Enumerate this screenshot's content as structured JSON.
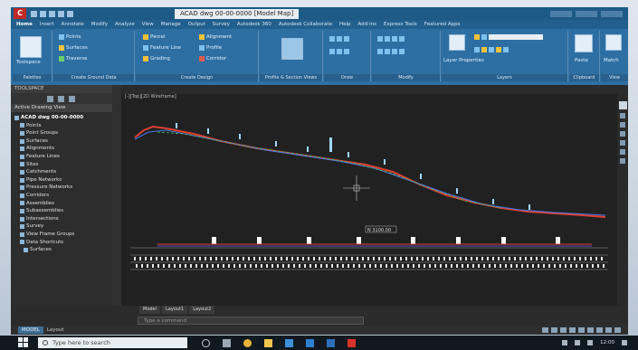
{
  "window": {
    "document_title": "ACAD dwg 00-00-0000 [Model Map]",
    "app_logo": "C"
  },
  "ribbon": {
    "tabs": [
      "Home",
      "Insert",
      "Annotate",
      "Modify",
      "Analyze",
      "View",
      "Manage",
      "Output",
      "Survey",
      "Autodesk 360",
      "Autodesk Collaborate",
      "Help",
      "Add-ins",
      "Express Tools",
      "Featured Apps"
    ],
    "panels": {
      "palettes": "Palettes",
      "create_ground_data": "Create Ground Data",
      "create_design": "Create Design",
      "profile_section_views": "Profile & Section Views",
      "draw": "Draw",
      "modify": "Modify",
      "layers": "Layers",
      "clipboard": "Clipboard",
      "view": "View"
    },
    "items": {
      "toolspace": "Toolspace",
      "points": "Points",
      "surfaces": "Surfaces",
      "traverse": "Traverse",
      "parcel": "Parcel",
      "feature_line": "Feature Line",
      "grading": "Grading",
      "alignment": "Alignment",
      "profile": "Profile",
      "corridor": "Corridor",
      "layer_properties": "Layer Properties",
      "paste": "Paste",
      "match": "Match"
    }
  },
  "toolspace": {
    "header": "TOOLSPACE",
    "view_label": "Active Drawing View",
    "tree": [
      {
        "label": "ACAD dwg 00-00-0000",
        "level": "root"
      },
      {
        "label": "Points",
        "level": "l1"
      },
      {
        "label": "Point Groups",
        "level": "l1"
      },
      {
        "label": "Surfaces",
        "level": "l1"
      },
      {
        "label": "Alignments",
        "level": "l1"
      },
      {
        "label": "Feature Lines",
        "level": "l1"
      },
      {
        "label": "Sites",
        "level": "l1"
      },
      {
        "label": "Catchments",
        "level": "l1"
      },
      {
        "label": "Pipe Networks",
        "level": "l1"
      },
      {
        "label": "Pressure Networks",
        "level": "l1"
      },
      {
        "label": "Corridors",
        "level": "l1"
      },
      {
        "label": "Assemblies",
        "level": "l1"
      },
      {
        "label": "Subassemblies",
        "level": "l1"
      },
      {
        "label": "Intersections",
        "level": "l1"
      },
      {
        "label": "Survey",
        "level": "l1"
      },
      {
        "label": "View Frame Groups",
        "level": "l1"
      },
      {
        "label": "Data Shortcuts",
        "level": "l1"
      },
      {
        "label": "Surfaces",
        "level": "l2"
      }
    ]
  },
  "canvas": {
    "viewport_label": "[-][Top][2D Wireframe]",
    "center_label": "N 3100.00"
  },
  "layout_tabs": [
    "Model",
    "Layout1",
    "Layout2"
  ],
  "command_line": {
    "placeholder": "Type a command"
  },
  "status": {
    "model": "MODEL",
    "layout": "Layout"
  },
  "taskbar": {
    "search_placeholder": "Type here to search",
    "time": "12:00"
  },
  "colors": {
    "ribbon": "#2e6fa3",
    "title": "#1d5a86",
    "canvas": "#212121",
    "profile_red": "#e04030",
    "profile_blue": "#4a78e8",
    "profile_green": "#3fbf5a"
  }
}
